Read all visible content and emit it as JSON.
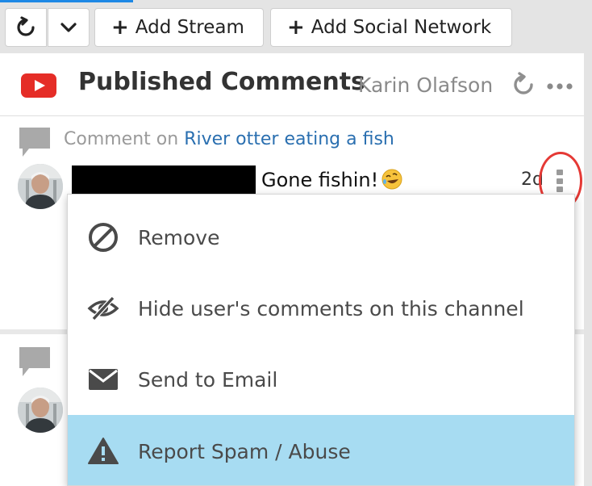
{
  "toolbar": {
    "add_stream_label": "Add Stream",
    "add_social_label": "Add Social Network",
    "plus_glyph": "+"
  },
  "stream": {
    "title": "Published Comments",
    "account": "Karin Olafson",
    "network_icon": "youtube-logo-icon",
    "brand_color": "#e52d27"
  },
  "comments": [
    {
      "context_prefix": "Comment on",
      "context_link": "River otter eating a fish",
      "text": "Gone fishin!",
      "emoji_icon": "rolling-on-floor-laughing-emoji-icon",
      "time": "2d",
      "author_redacted": true
    },
    {
      "author_redacted": true
    }
  ],
  "menu": {
    "items": [
      {
        "label": "Remove",
        "icon": "prohibited-icon"
      },
      {
        "label": "Hide user's comments on this channel",
        "icon": "eye-slash-icon"
      },
      {
        "label": "Send to Email",
        "icon": "envelope-icon"
      },
      {
        "label": "Report Spam / Abuse",
        "icon": "warning-triangle-icon",
        "highlighted": true
      }
    ],
    "highlight_color": "#a7dcf2"
  },
  "annotation": {
    "ring_color": "#e53935"
  }
}
